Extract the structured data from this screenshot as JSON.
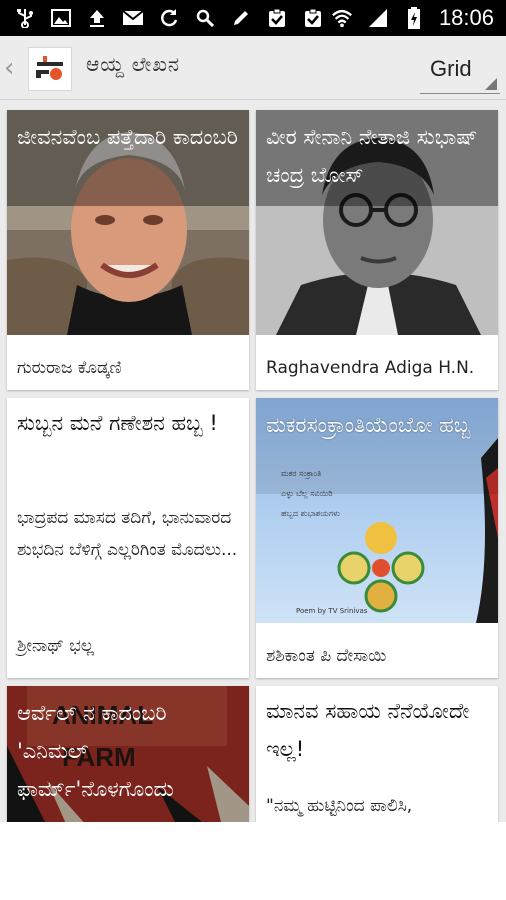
{
  "status_bar": {
    "time": "18:06",
    "icons": [
      "usb-icon",
      "image-icon",
      "upload-icon",
      "mail-icon",
      "sync-icon",
      "search-icon",
      "pencil-icon",
      "clipboard-check-icon",
      "clipboard-check-icon",
      "wifi-icon",
      "signal-icon",
      "battery-charging-icon"
    ]
  },
  "action_bar": {
    "back_glyph": "‹",
    "title": "ಆಯ್ದ ಲೇಖನ",
    "view_mode": "Grid"
  },
  "cards": [
    {
      "title": "ಜೀವನವೆಂಬ ಪತ್ತೆದಾರಿ ಕಾದಂಬರಿ",
      "author": "ಗುರುರಾಜ ಕೊಡ್ಕಣಿ",
      "has_image": true
    },
    {
      "title": "ವೀರ ಸೇನಾನಿ ನೇತಾಜಿ ಸುಭಾಷ್ ಚಂದ್ರ ಬೋಸ್",
      "author": "Raghavendra Adiga H.N.",
      "has_image": true
    },
    {
      "title": "ಸುಬ್ಬನ ಮನೆ ಗಣೇಶನ ಹಬ್ಬ !",
      "excerpt": "ಭಾದ್ರಪದ ಮಾಸದ ತದಿಗೆ, ಭಾನುವಾರದ ಶುಭದಿನ ಬೆಳಿಗ್ಗೆ ಎಲ್ಲರಿಗಿಂತ ಮೊದಲು...",
      "author": "ಶ್ರೀನಾಥ್ ಭಲ್ಲ",
      "has_image": false
    },
    {
      "title": "ಮಕರಸಂಕ್ರಾಂತಿಯೆಂಬೋ ಹಬ್ಬ",
      "author": "ಶಶಿಕಾಂತ ಪಿ ದೇಸಾಯಿ",
      "has_image": true
    },
    {
      "title": "ಆರ್ವೆಲ್ ನ ಕಾದಂಬರಿ 'ಎನಿಮಲ್ ಫಾರ್ಮ್'ನೊಳಗೊಂದು",
      "has_image": true
    },
    {
      "title": "ಮಾನವ ಸಹಾಯ ನೆನೆಯೋದೇ ಇಲ್ಲ!",
      "excerpt": "\"ನಮ್ಮ ಹುಟ್ಟಿನಿಂದ ಪಾಲಿಸಿ,",
      "has_image": false
    }
  ],
  "colors": {
    "status_bar": "#000000",
    "action_bar": "#ececec",
    "grid_bg": "#ebebeb",
    "logo_accent": "#e2552a"
  }
}
